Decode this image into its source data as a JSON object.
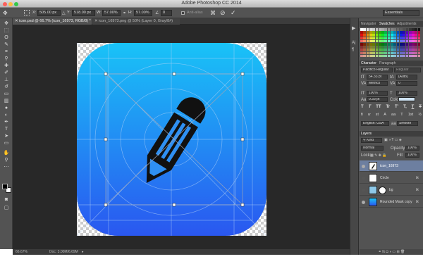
{
  "window": {
    "title": "Adobe Photoshop CC 2014",
    "colors": {
      "close": "#fc605b",
      "minimize": "#fdbc40",
      "zoom": "#34c84a"
    }
  },
  "options_bar": {
    "x_label": "X:",
    "x_value": "505.00 px",
    "y_label": "Y:",
    "y_value": "518.00 px",
    "w_label": "W:",
    "w_value": "57.00%",
    "h_label": "H:",
    "h_value": "57.00%",
    "angle_value": "0",
    "antialias_label": "Anti-alias",
    "workspace_value": "Essentials"
  },
  "document_tabs": [
    {
      "label": "icon.psd @ 66.7% (icon_16973, RGB/8) *",
      "active": true
    },
    {
      "label": "icon_16973.png @ 50% (Layer 0, Gray/8#)",
      "active": false
    }
  ],
  "status_bar": {
    "zoom": "66.67%",
    "doc": "Doc: 3.00M/6.69M"
  },
  "swatches_panel": {
    "tabs": [
      "Navigator",
      "Swatches",
      "Adjustments"
    ],
    "active_tab": "Swatches"
  },
  "character_panel": {
    "tabs": [
      "Character",
      "Paragraph"
    ],
    "font_family": "Pacifico Regular",
    "font_style": "Regular",
    "font_size": "54.33 pt",
    "leading": "(Auto)",
    "kerning": "Metrics",
    "tracking": "0",
    "vertical_scale": "100%",
    "horizontal_scale": "100%",
    "baseline_shift": "0.33 pt",
    "color_label": "Color:",
    "style_buttons": [
      "T",
      "T",
      "TT",
      "Tr",
      "T'",
      "T,",
      "T",
      "T"
    ],
    "opentype_buttons": [
      "fi",
      "ư",
      "st",
      "A",
      "aa",
      "T",
      "1st",
      "½"
    ],
    "language": "English: USA",
    "aa_prefix": "aa",
    "antialias": "Smooth"
  },
  "layers_panel": {
    "title": "Layers",
    "filter": "Kind",
    "blend_mode": "Normal",
    "opacity_label": "Opacity:",
    "opacity_value": "100%",
    "lock_label": "Lock:",
    "fill_label": "Fill:",
    "fill_value": "100%",
    "fx_symbol": "fx",
    "layers": [
      {
        "name": "icon_16973",
        "selected": true,
        "fx": false
      },
      {
        "name": "Circle",
        "selected": false,
        "fx": true
      },
      {
        "name": "bg",
        "selected": false,
        "fx": true
      },
      {
        "name": "Rounded Mask copy",
        "selected": false,
        "fx": true
      }
    ]
  },
  "canvas": {
    "icon_gradient_top": "#19c3f7",
    "icon_gradient_bottom": "#2a57f0"
  }
}
